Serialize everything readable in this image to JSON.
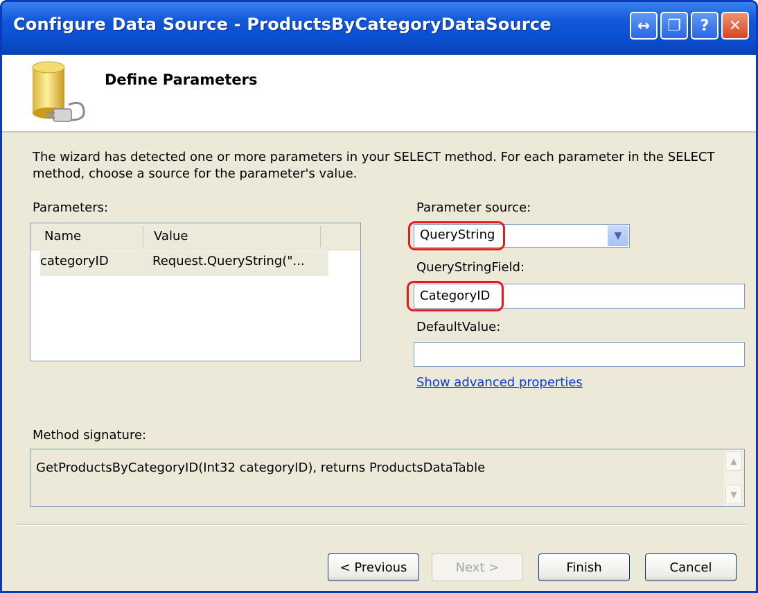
{
  "window": {
    "title": "Configure Data Source - ProductsByCategoryDataSource",
    "controls": {
      "restore": "↔",
      "maximize": "❐",
      "help": "?",
      "close": "✕"
    }
  },
  "header": {
    "title": "Define Parameters",
    "icon": "database-plug-icon"
  },
  "intro_text": "The wizard has detected one or more parameters in your SELECT method. For each parameter in the SELECT method, choose a source for the parameter's value.",
  "parameters": {
    "label": "Parameters:",
    "columns": [
      "Name",
      "Value"
    ],
    "rows": [
      {
        "name": "categoryID",
        "value": "Request.QueryString(\"..."
      }
    ]
  },
  "parameter_source": {
    "label": "Parameter source:",
    "value": "QueryString"
  },
  "query_string_field": {
    "label": "QueryStringField:",
    "value": "CategoryID"
  },
  "default_value": {
    "label": "DefaultValue:",
    "value": ""
  },
  "advanced_link": "Show advanced properties",
  "method_signature": {
    "label": "Method signature:",
    "value": "GetProductsByCategoryID(Int32 categoryID), returns ProductsDataTable"
  },
  "buttons": {
    "previous": "< Previous",
    "next": "Next >",
    "finish": "Finish",
    "cancel": "Cancel"
  },
  "colors": {
    "titlebar": "#0a4fd1",
    "highlight_ring": "#e8181f",
    "link": "#0a3ccf"
  }
}
